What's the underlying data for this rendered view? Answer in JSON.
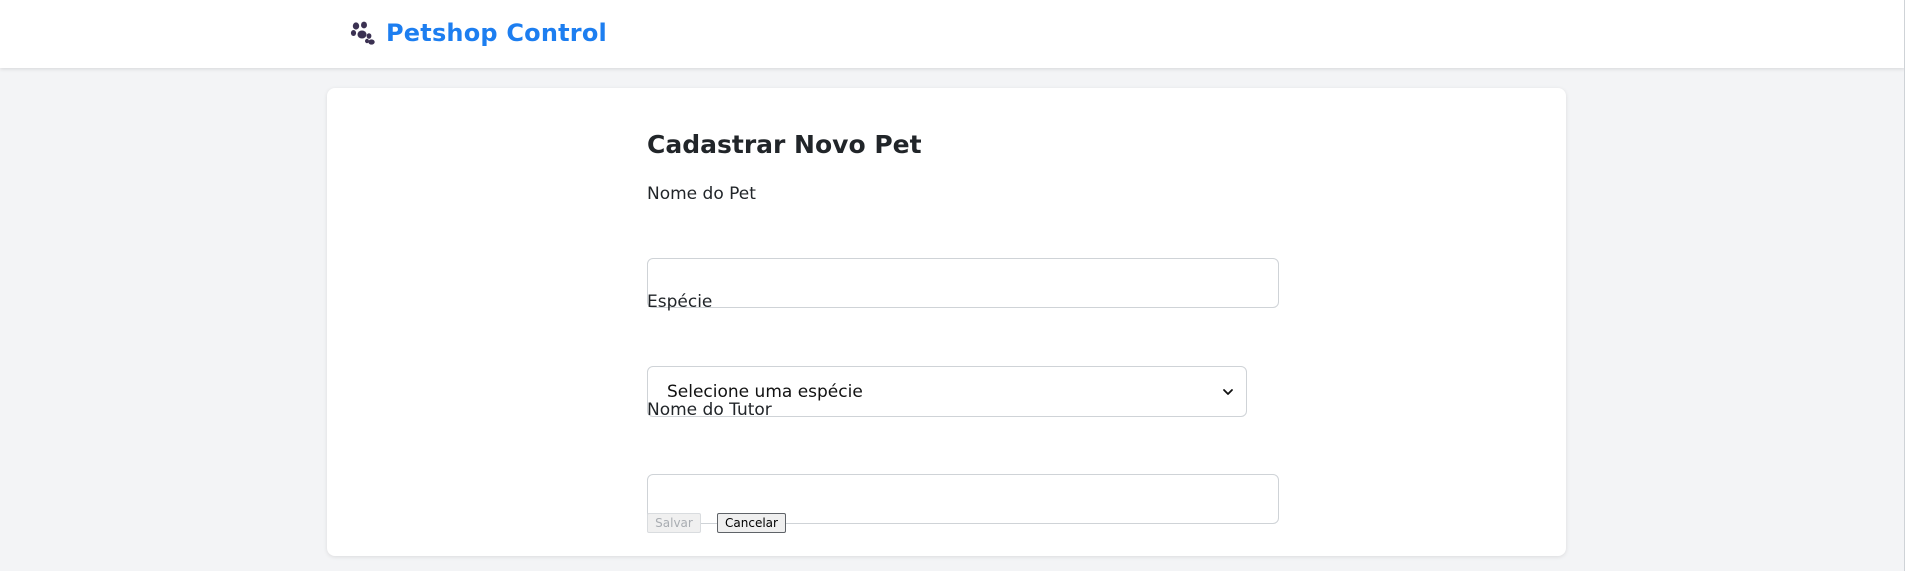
{
  "header": {
    "brand_icon": "paw-icon",
    "brand_title": "Petshop Control",
    "brand_color": "#1d7ef0"
  },
  "form": {
    "title": "Cadastrar Novo Pet",
    "pet_name": {
      "label": "Nome do Pet",
      "value": "",
      "placeholder": ""
    },
    "species": {
      "label": "Espécie",
      "selected": "Selecione uma espécie"
    },
    "owner_name": {
      "label": "Nome do Tutor",
      "value": "",
      "placeholder": ""
    },
    "buttons": {
      "save": "Salvar",
      "cancel": "Cancelar",
      "save_disabled": true
    }
  }
}
